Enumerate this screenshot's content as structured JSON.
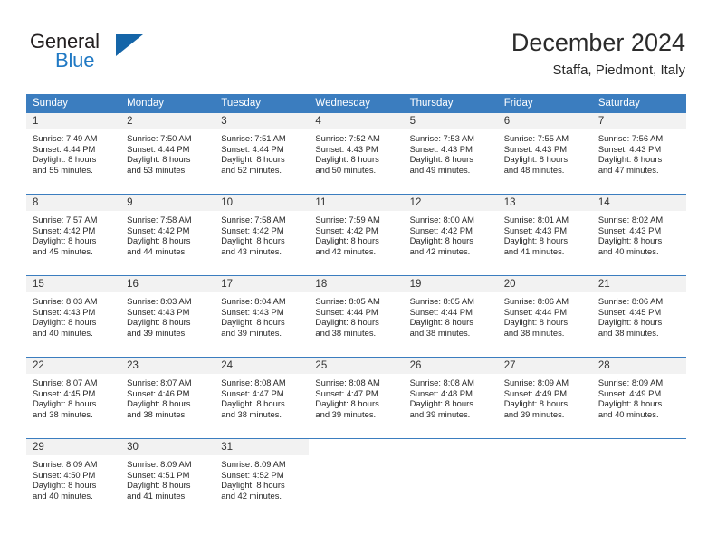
{
  "brand": {
    "name_part1": "General",
    "name_part2": "Blue",
    "logo_icon": "triangle-flag-icon"
  },
  "header": {
    "month_title": "December 2024",
    "location": "Staffa, Piedmont, Italy"
  },
  "calendar": {
    "weekday_headers": [
      "Sunday",
      "Monday",
      "Tuesday",
      "Wednesday",
      "Thursday",
      "Friday",
      "Saturday"
    ],
    "accent_color": "#3b7dbf",
    "daynum_band_color": "#f2f2f2",
    "weeks": [
      [
        {
          "day": "",
          "lines": []
        },
        {
          "day": "",
          "lines": []
        },
        {
          "day": "",
          "lines": []
        },
        {
          "day": "",
          "lines": []
        },
        {
          "day": "",
          "lines": []
        },
        {
          "day": "",
          "lines": []
        },
        {
          "day": "",
          "lines": []
        }
      ]
    ],
    "days": [
      {
        "day": "1",
        "weekday": "Sunday",
        "sunrise": "Sunrise: 7:49 AM",
        "sunset": "Sunset: 4:44 PM",
        "daylight_line1": "Daylight: 8 hours",
        "daylight_line2": "and 55 minutes."
      },
      {
        "day": "2",
        "weekday": "Monday",
        "sunrise": "Sunrise: 7:50 AM",
        "sunset": "Sunset: 4:44 PM",
        "daylight_line1": "Daylight: 8 hours",
        "daylight_line2": "and 53 minutes."
      },
      {
        "day": "3",
        "weekday": "Tuesday",
        "sunrise": "Sunrise: 7:51 AM",
        "sunset": "Sunset: 4:44 PM",
        "daylight_line1": "Daylight: 8 hours",
        "daylight_line2": "and 52 minutes."
      },
      {
        "day": "4",
        "weekday": "Wednesday",
        "sunrise": "Sunrise: 7:52 AM",
        "sunset": "Sunset: 4:43 PM",
        "daylight_line1": "Daylight: 8 hours",
        "daylight_line2": "and 50 minutes."
      },
      {
        "day": "5",
        "weekday": "Thursday",
        "sunrise": "Sunrise: 7:53 AM",
        "sunset": "Sunset: 4:43 PM",
        "daylight_line1": "Daylight: 8 hours",
        "daylight_line2": "and 49 minutes."
      },
      {
        "day": "6",
        "weekday": "Friday",
        "sunrise": "Sunrise: 7:55 AM",
        "sunset": "Sunset: 4:43 PM",
        "daylight_line1": "Daylight: 8 hours",
        "daylight_line2": "and 48 minutes."
      },
      {
        "day": "7",
        "weekday": "Saturday",
        "sunrise": "Sunrise: 7:56 AM",
        "sunset": "Sunset: 4:43 PM",
        "daylight_line1": "Daylight: 8 hours",
        "daylight_line2": "and 47 minutes."
      },
      {
        "day": "8",
        "weekday": "Sunday",
        "sunrise": "Sunrise: 7:57 AM",
        "sunset": "Sunset: 4:42 PM",
        "daylight_line1": "Daylight: 8 hours",
        "daylight_line2": "and 45 minutes."
      },
      {
        "day": "9",
        "weekday": "Monday",
        "sunrise": "Sunrise: 7:58 AM",
        "sunset": "Sunset: 4:42 PM",
        "daylight_line1": "Daylight: 8 hours",
        "daylight_line2": "and 44 minutes."
      },
      {
        "day": "10",
        "weekday": "Tuesday",
        "sunrise": "Sunrise: 7:58 AM",
        "sunset": "Sunset: 4:42 PM",
        "daylight_line1": "Daylight: 8 hours",
        "daylight_line2": "and 43 minutes."
      },
      {
        "day": "11",
        "weekday": "Wednesday",
        "sunrise": "Sunrise: 7:59 AM",
        "sunset": "Sunset: 4:42 PM",
        "daylight_line1": "Daylight: 8 hours",
        "daylight_line2": "and 42 minutes."
      },
      {
        "day": "12",
        "weekday": "Thursday",
        "sunrise": "Sunrise: 8:00 AM",
        "sunset": "Sunset: 4:42 PM",
        "daylight_line1": "Daylight: 8 hours",
        "daylight_line2": "and 42 minutes."
      },
      {
        "day": "13",
        "weekday": "Friday",
        "sunrise": "Sunrise: 8:01 AM",
        "sunset": "Sunset: 4:43 PM",
        "daylight_line1": "Daylight: 8 hours",
        "daylight_line2": "and 41 minutes."
      },
      {
        "day": "14",
        "weekday": "Saturday",
        "sunrise": "Sunrise: 8:02 AM",
        "sunset": "Sunset: 4:43 PM",
        "daylight_line1": "Daylight: 8 hours",
        "daylight_line2": "and 40 minutes."
      },
      {
        "day": "15",
        "weekday": "Sunday",
        "sunrise": "Sunrise: 8:03 AM",
        "sunset": "Sunset: 4:43 PM",
        "daylight_line1": "Daylight: 8 hours",
        "daylight_line2": "and 40 minutes."
      },
      {
        "day": "16",
        "weekday": "Monday",
        "sunrise": "Sunrise: 8:03 AM",
        "sunset": "Sunset: 4:43 PM",
        "daylight_line1": "Daylight: 8 hours",
        "daylight_line2": "and 39 minutes."
      },
      {
        "day": "17",
        "weekday": "Tuesday",
        "sunrise": "Sunrise: 8:04 AM",
        "sunset": "Sunset: 4:43 PM",
        "daylight_line1": "Daylight: 8 hours",
        "daylight_line2": "and 39 minutes."
      },
      {
        "day": "18",
        "weekday": "Wednesday",
        "sunrise": "Sunrise: 8:05 AM",
        "sunset": "Sunset: 4:44 PM",
        "daylight_line1": "Daylight: 8 hours",
        "daylight_line2": "and 38 minutes."
      },
      {
        "day": "19",
        "weekday": "Thursday",
        "sunrise": "Sunrise: 8:05 AM",
        "sunset": "Sunset: 4:44 PM",
        "daylight_line1": "Daylight: 8 hours",
        "daylight_line2": "and 38 minutes."
      },
      {
        "day": "20",
        "weekday": "Friday",
        "sunrise": "Sunrise: 8:06 AM",
        "sunset": "Sunset: 4:44 PM",
        "daylight_line1": "Daylight: 8 hours",
        "daylight_line2": "and 38 minutes."
      },
      {
        "day": "21",
        "weekday": "Saturday",
        "sunrise": "Sunrise: 8:06 AM",
        "sunset": "Sunset: 4:45 PM",
        "daylight_line1": "Daylight: 8 hours",
        "daylight_line2": "and 38 minutes."
      },
      {
        "day": "22",
        "weekday": "Sunday",
        "sunrise": "Sunrise: 8:07 AM",
        "sunset": "Sunset: 4:45 PM",
        "daylight_line1": "Daylight: 8 hours",
        "daylight_line2": "and 38 minutes."
      },
      {
        "day": "23",
        "weekday": "Monday",
        "sunrise": "Sunrise: 8:07 AM",
        "sunset": "Sunset: 4:46 PM",
        "daylight_line1": "Daylight: 8 hours",
        "daylight_line2": "and 38 minutes."
      },
      {
        "day": "24",
        "weekday": "Tuesday",
        "sunrise": "Sunrise: 8:08 AM",
        "sunset": "Sunset: 4:47 PM",
        "daylight_line1": "Daylight: 8 hours",
        "daylight_line2": "and 38 minutes."
      },
      {
        "day": "25",
        "weekday": "Wednesday",
        "sunrise": "Sunrise: 8:08 AM",
        "sunset": "Sunset: 4:47 PM",
        "daylight_line1": "Daylight: 8 hours",
        "daylight_line2": "and 39 minutes."
      },
      {
        "day": "26",
        "weekday": "Thursday",
        "sunrise": "Sunrise: 8:08 AM",
        "sunset": "Sunset: 4:48 PM",
        "daylight_line1": "Daylight: 8 hours",
        "daylight_line2": "and 39 minutes."
      },
      {
        "day": "27",
        "weekday": "Friday",
        "sunrise": "Sunrise: 8:09 AM",
        "sunset": "Sunset: 4:49 PM",
        "daylight_line1": "Daylight: 8 hours",
        "daylight_line2": "and 39 minutes."
      },
      {
        "day": "28",
        "weekday": "Saturday",
        "sunrise": "Sunrise: 8:09 AM",
        "sunset": "Sunset: 4:49 PM",
        "daylight_line1": "Daylight: 8 hours",
        "daylight_line2": "and 40 minutes."
      },
      {
        "day": "29",
        "weekday": "Sunday",
        "sunrise": "Sunrise: 8:09 AM",
        "sunset": "Sunset: 4:50 PM",
        "daylight_line1": "Daylight: 8 hours",
        "daylight_line2": "and 40 minutes."
      },
      {
        "day": "30",
        "weekday": "Monday",
        "sunrise": "Sunrise: 8:09 AM",
        "sunset": "Sunset: 4:51 PM",
        "daylight_line1": "Daylight: 8 hours",
        "daylight_line2": "and 41 minutes."
      },
      {
        "day": "31",
        "weekday": "Tuesday",
        "sunrise": "Sunrise: 8:09 AM",
        "sunset": "Sunset: 4:52 PM",
        "daylight_line1": "Daylight: 8 hours",
        "daylight_line2": "and 42 minutes."
      }
    ],
    "leading_blanks": 0,
    "trailing_blanks": 4
  }
}
